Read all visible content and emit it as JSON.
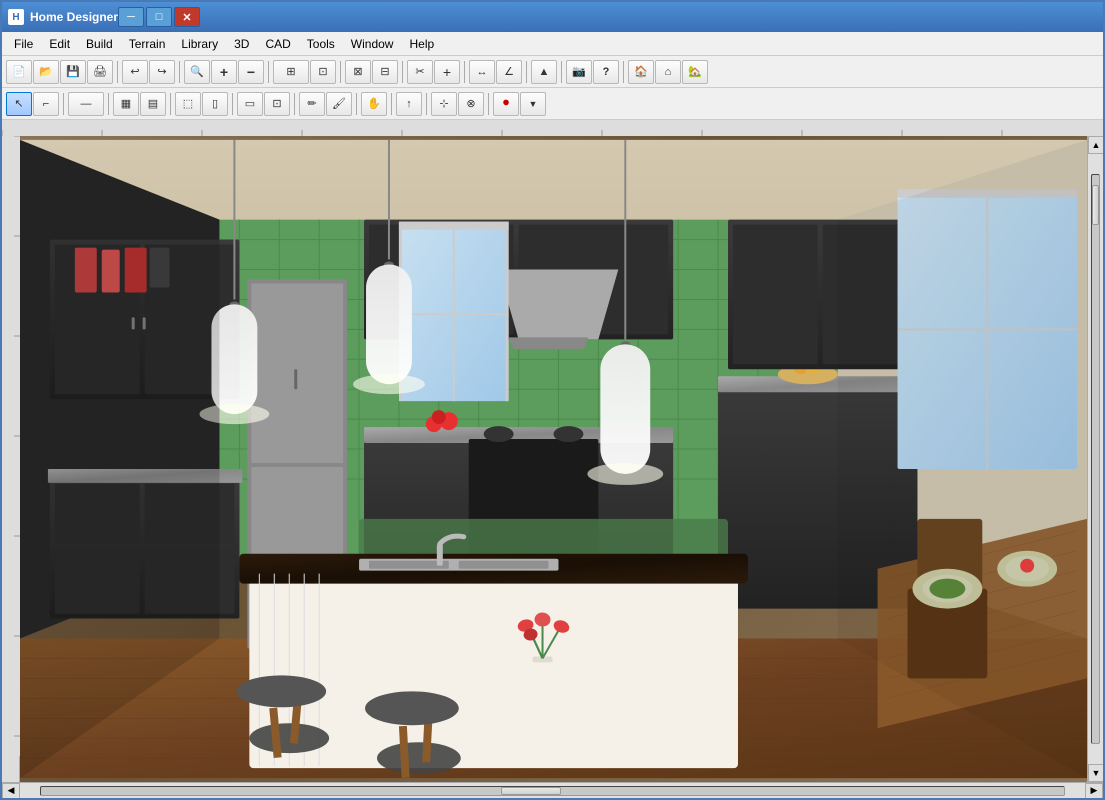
{
  "window": {
    "title": "Home Designer",
    "icon_text": "H"
  },
  "title_controls": {
    "minimize": "─",
    "maximize": "□",
    "close": "✕"
  },
  "menu": {
    "items": [
      "File",
      "Edit",
      "Build",
      "Terrain",
      "Library",
      "3D",
      "CAD",
      "Tools",
      "Window",
      "Help"
    ]
  },
  "toolbar1": {
    "buttons": [
      {
        "name": "new",
        "icon": "📄"
      },
      {
        "name": "open",
        "icon": "📁"
      },
      {
        "name": "save",
        "icon": "💾"
      },
      {
        "name": "print",
        "icon": "🖨"
      },
      {
        "name": "sep1",
        "icon": ""
      },
      {
        "name": "undo",
        "icon": "↩"
      },
      {
        "name": "redo",
        "icon": "↪"
      },
      {
        "name": "sep2",
        "icon": ""
      },
      {
        "name": "zoom-in-out",
        "icon": "🔍"
      },
      {
        "name": "zoom-in",
        "icon": "⊕"
      },
      {
        "name": "zoom-out",
        "icon": "⊖"
      },
      {
        "name": "sep3",
        "icon": ""
      },
      {
        "name": "zoom-fit",
        "icon": "⊞"
      },
      {
        "name": "sep4",
        "icon": ""
      },
      {
        "name": "tool1",
        "icon": "◈"
      },
      {
        "name": "tool2",
        "icon": "◉"
      },
      {
        "name": "sep5",
        "icon": ""
      },
      {
        "name": "tool3",
        "icon": "✂"
      },
      {
        "name": "tool4",
        "icon": "⊕"
      },
      {
        "name": "sep6",
        "icon": ""
      },
      {
        "name": "measure",
        "icon": "📏"
      },
      {
        "name": "sep7",
        "icon": ""
      },
      {
        "name": "tool5",
        "icon": "▲"
      },
      {
        "name": "sep8",
        "icon": ""
      },
      {
        "name": "camera",
        "icon": "📷"
      },
      {
        "name": "question",
        "icon": "?"
      },
      {
        "name": "sep9",
        "icon": ""
      },
      {
        "name": "house",
        "icon": "🏠"
      },
      {
        "name": "house2",
        "icon": "⌂"
      },
      {
        "name": "house3",
        "icon": "🏡"
      }
    ]
  },
  "toolbar2": {
    "buttons": [
      {
        "name": "select",
        "icon": "↖",
        "selected": true
      },
      {
        "name": "polyline",
        "icon": "⌐"
      },
      {
        "name": "sep1",
        "icon": ""
      },
      {
        "name": "line-tool",
        "icon": "—"
      },
      {
        "name": "sep2",
        "icon": ""
      },
      {
        "name": "fill",
        "icon": "▦"
      },
      {
        "name": "sep3",
        "icon": ""
      },
      {
        "name": "cabinet",
        "icon": "⬚"
      },
      {
        "name": "sep4",
        "icon": ""
      },
      {
        "name": "door",
        "icon": "▯"
      },
      {
        "name": "sep5",
        "icon": ""
      },
      {
        "name": "stair",
        "icon": "▤"
      },
      {
        "name": "sep6",
        "icon": ""
      },
      {
        "name": "pencil",
        "icon": "✏"
      },
      {
        "name": "brush",
        "icon": "🖌"
      },
      {
        "name": "sep7",
        "icon": ""
      },
      {
        "name": "hand",
        "icon": "✋"
      },
      {
        "name": "sep8",
        "icon": ""
      },
      {
        "name": "arrow-up",
        "icon": "↑"
      },
      {
        "name": "sep9",
        "icon": ""
      },
      {
        "name": "move",
        "icon": "⊹"
      },
      {
        "name": "sep10",
        "icon": ""
      },
      {
        "name": "record",
        "icon": "⏺"
      }
    ]
  },
  "scene": {
    "description": "3D kitchen interior with dark cabinets, green tile backsplash, hardwood floors, island with sink, pendant lights, dining table"
  },
  "scrollbar": {
    "h_position": "45%",
    "v_position": "top: 10px"
  }
}
